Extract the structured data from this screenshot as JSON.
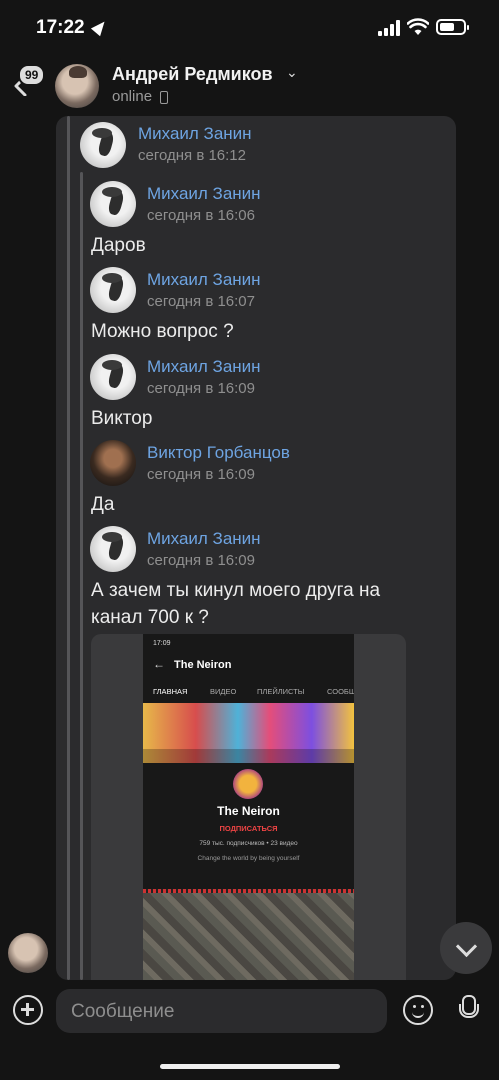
{
  "status_bar": {
    "time": "17:22"
  },
  "header": {
    "back_badge": "99",
    "name": "Андрей Редмиков",
    "status": "online"
  },
  "forwarded": [
    {
      "author": "Михаил Занин",
      "time": "сегодня в 16:12",
      "text": ""
    },
    {
      "author": "Михаил Занин",
      "time": "сегодня в 16:06",
      "text": "Даров"
    },
    {
      "author": "Михаил Занин",
      "time": "сегодня в 16:07",
      "text": "Можно вопрос ?"
    },
    {
      "author": "Михаил Занин",
      "time": "сегодня в 16:09",
      "text": "Виктор"
    },
    {
      "author": "Виктор Горбанцов",
      "time": "сегодня в 16:09",
      "text": "Да"
    },
    {
      "author": "Михаил Занин",
      "time": "сегодня в 16:09",
      "text": "А зачем ты кинул моего друга на канал 700 к ?"
    }
  ],
  "embedded_screenshot": {
    "time": "17:09",
    "channel_title": "The Neiron",
    "tabs": [
      "ГЛАВНАЯ",
      "ВИДЕО",
      "ПЛЕЙЛИСТЫ",
      "СООБЩ"
    ],
    "channel_name": "The Neiron",
    "subscribe": "ПОДПИСАТЬСЯ",
    "stats": "759 тыс. подписчиков • 23 видео",
    "slogan": "Change the world by being yourself"
  },
  "input": {
    "placeholder": "Сообщение"
  },
  "colors": {
    "link": "#6ea4e2",
    "background": "#141414",
    "bubble": "#2b2b2d"
  }
}
